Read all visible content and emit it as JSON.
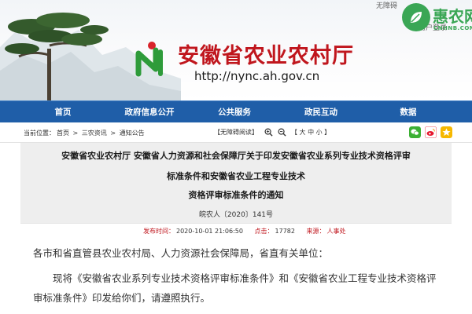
{
  "header": {
    "site_title": "安徽省农业农村厅",
    "site_url": "http://nync.ah.gov.cn",
    "top_link_1": "无障碍",
    "top_link_2": "用户登录"
  },
  "watermark": {
    "brand": "惠农网",
    "domain": "CNHNB.COM"
  },
  "nav": {
    "items": [
      {
        "label": "首页"
      },
      {
        "label": "政府信息公开"
      },
      {
        "label": "公共服务"
      },
      {
        "label": "政民互动"
      },
      {
        "label": "数据"
      }
    ]
  },
  "breadcrumb": {
    "prefix": "当前位置：",
    "items": [
      "首页",
      "三农资讯",
      "通知公告"
    ],
    "separator": ">"
  },
  "tools": {
    "accessible_read": "【无障碍阅读】",
    "font_size": "【 大 中 小 】"
  },
  "article": {
    "title_lines": [
      "安徽省农业农村厅 安徽省人力资源和社会保障厅关于印发安徽省农业系列专业技术资格评审",
      "标准条件和安徽省农业工程专业技术",
      "资格评审标准条件的通知"
    ],
    "doc_number": "皖农人〔2020〕141号",
    "publish_label": "发布时间：",
    "publish_time": "2020-10-01 21:06:50",
    "views_label": "点击：",
    "views": "17782",
    "source_label": "来源：",
    "source": "人事处",
    "para1": "各市和省直管县农业农村局、人力资源社会保障局，省直有关单位：",
    "para2": "现将《安徽省农业系列专业技术资格评审标准条件》和《安徽省农业工程专业技术资格评审标准条件》印发给你们，请遵照执行。"
  },
  "colors": {
    "brand_red": "#c0161d",
    "nav_blue": "#1f5ea8",
    "watermark_green": "#3aa655",
    "wechat_green": "#3cb034",
    "weibo_red": "#e6162d"
  }
}
